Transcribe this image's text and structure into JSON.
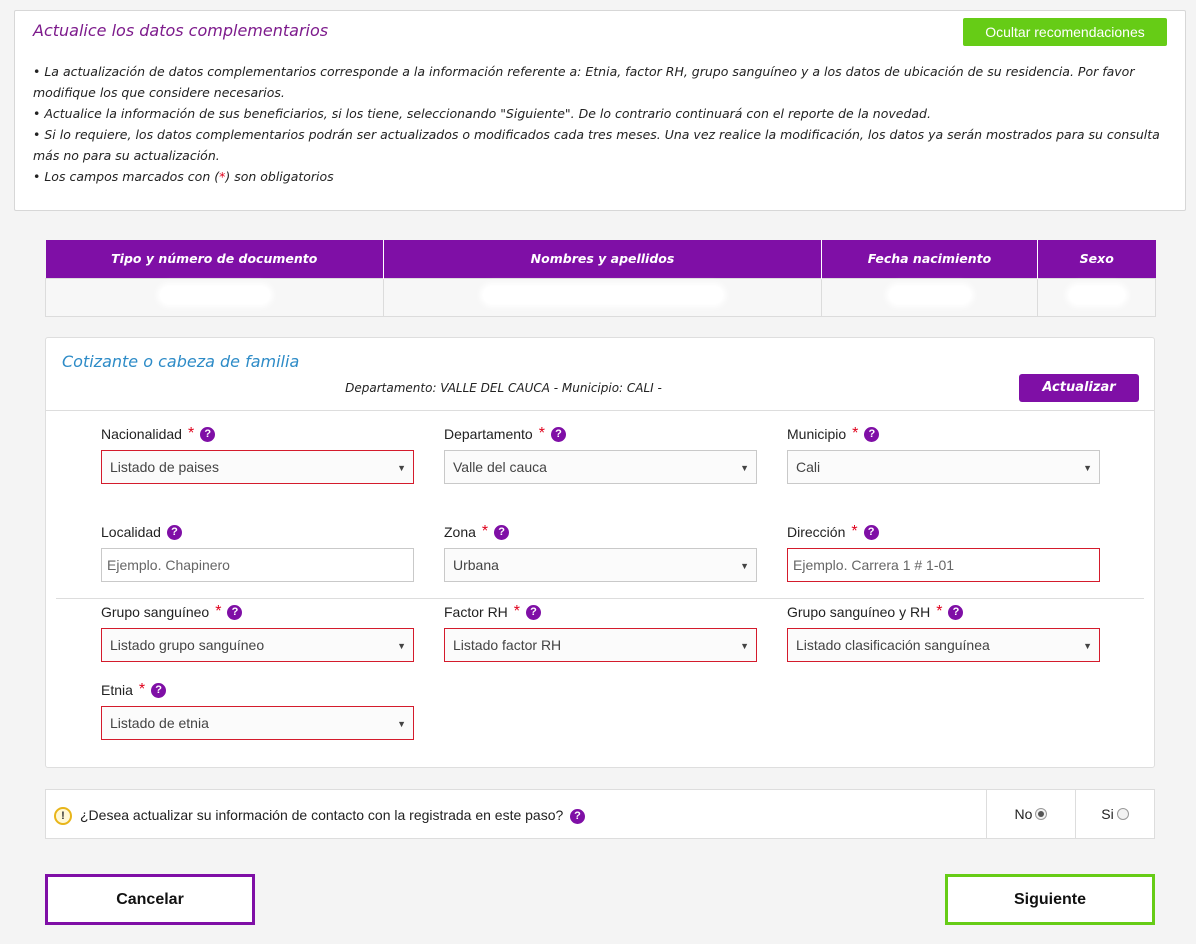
{
  "recommendations": {
    "title": "Actualice los datos complementarios",
    "hide_button": "Ocultar recomendaciones",
    "items": [
      "• La actualización de datos complementarios corresponde a la información referente a: Etnia, factor RH, grupo sanguíneo y a los datos de ubicación de su residencia. Por favor modifique los que considere necesarios.",
      "• Actualice la información de sus beneficiarios, si los tiene, seleccionando \"Siguiente\". De lo contrario continuará con el reporte de la novedad.",
      "• Si lo requiere, los datos complementarios podrán ser actualizados o modificados cada tres meses. Una vez realice la modificación, los datos ya serán mostrados para su consulta más no para su actualización."
    ],
    "required_note": {
      "before": "• Los campos marcados con (",
      "star": "*",
      "after": ") son obligatorios"
    }
  },
  "person_table": {
    "headers": [
      "Tipo y número de documento",
      "Nombres y apellidos",
      "Fecha nacimiento",
      "Sexo"
    ]
  },
  "form": {
    "title": "Cotizante o cabeza de familia",
    "location_line": "Departamento: VALLE DEL CAUCA - Municipio: CALI -",
    "update_button": "Actualizar",
    "required_star": "*",
    "help_glyph": "?",
    "fields": {
      "nationality": {
        "label": "Nacionalidad",
        "value": "Listado de paises"
      },
      "department": {
        "label": "Departamento",
        "value": "Valle del cauca"
      },
      "municipality": {
        "label": "Municipio",
        "value": "Cali"
      },
      "locality": {
        "label": "Localidad",
        "placeholder": "Ejemplo. Chapinero"
      },
      "zone": {
        "label": "Zona",
        "value": "Urbana"
      },
      "address": {
        "label": "Dirección",
        "placeholder": "Ejemplo. Carrera 1 # 1-01"
      },
      "blood_group": {
        "label": "Grupo sanguíneo",
        "value": "Listado grupo sanguíneo"
      },
      "rh_factor": {
        "label": "Factor RH",
        "value": "Listado factor RH"
      },
      "blood_group_rh": {
        "label": "Grupo sanguíneo y RH",
        "value": "Listado clasificación sanguínea"
      },
      "ethnicity": {
        "label": "Etnia",
        "value": "Listado de etnia"
      }
    }
  },
  "contact": {
    "warning_glyph": "!",
    "question": "¿Desea actualizar su información de contacto con la registrada en este paso?",
    "no_label": "No",
    "yes_label": "Si",
    "selected": "No"
  },
  "actions": {
    "cancel": "Cancelar",
    "next": "Siguiente"
  },
  "colors": {
    "brand_purple": "#7f0fa6",
    "accent_green": "#66cc16",
    "title_purple": "#7d1b8c",
    "form_title_blue": "#2d8bc7",
    "required_red": "#e0001b"
  }
}
